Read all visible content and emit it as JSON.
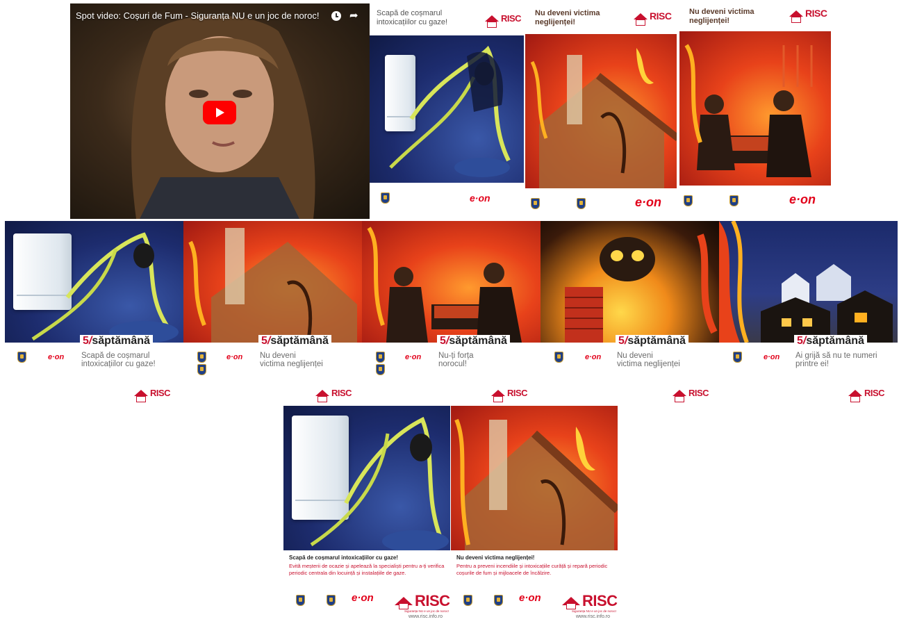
{
  "video": {
    "title": "Spot video: Coșuri de Fum - Siguranța NU e un joc de noroc!"
  },
  "colors": {
    "risc_red": "#c8102e",
    "eon_red": "#e2001a",
    "youtube_red": "#ff0000"
  },
  "top_posters": [
    {
      "headline": "Scapă de coșmarul intoxicațiilor cu gaze!",
      "logo": "RISC",
      "partner": "e·on"
    },
    {
      "headline": "Nu deveni victima neglijenței!",
      "logo": "RISC",
      "partner": "e·on"
    },
    {
      "headline": "Nu deveni victima neglijenței!",
      "logo": "RISC",
      "partner": "e·on"
    }
  ],
  "bottom_brand": {
    "partner": "e·on",
    "logo": "RISC",
    "week_five": "5",
    "week_slash": "/",
    "week_word": "săptămână"
  },
  "mid_posters": [
    {
      "title_lines": [
        "Scapă de coșmarul",
        "intoxicațiilor cu gaze!"
      ]
    },
    {
      "title_lines": [
        "Nu deveni",
        "victima neglijenței"
      ]
    },
    {
      "title_lines": [
        "Nu-ți forța",
        "norocul!"
      ]
    },
    {
      "title_lines": [
        "Nu deveni",
        "victima neglijenței"
      ]
    },
    {
      "title_lines": [
        "Ai grijă să nu te numeri",
        "printre ei!"
      ]
    }
  ],
  "bottom_posters": [
    {
      "heading": "Scapă de coșmarul intoxicațiilor cu gaze!",
      "body": "Evită meșterii de ocazie și apelează la specialiști pentru a-ți verifica periodic centrala din locuință și instalațiile de gaze.",
      "logo": "RISC",
      "tagline": "Siguranța NU e un joc de noroc!",
      "url": "www.risc.info.ro",
      "partner": "e·on"
    },
    {
      "heading": "Nu deveni victima neglijenței!",
      "body": "Pentru a preveni incendiile și intoxicațiile curăță și repară periodic coșurile de fum și mijloacele de încălzire.",
      "logo": "RISC",
      "tagline": "Siguranța NU e un joc de noroc!",
      "url": "www.risc.info.ro",
      "partner": "e·on"
    }
  ]
}
